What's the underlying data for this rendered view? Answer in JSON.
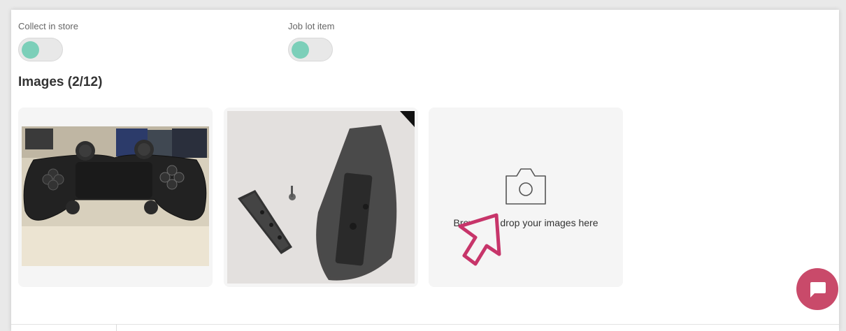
{
  "toggles": {
    "collect_in_store": {
      "label": "Collect in store",
      "on": false
    },
    "job_lot_item": {
      "label": "Job lot item",
      "on": false
    }
  },
  "images_section": {
    "title": "Images (2/12)",
    "count": 2,
    "max": 12
  },
  "uploaded_images": [
    {
      "subject": "black game controller photo"
    },
    {
      "subject": "black stand pieces photo"
    }
  ],
  "upload": {
    "text": "Browse or drop your images here",
    "icon": "camera-icon"
  },
  "chat": {
    "icon": "chat-bubble-icon"
  },
  "colors": {
    "toggle_knob": "#7ccfb9",
    "chat_button": "#c94a6a",
    "cursor": "#c7356a"
  }
}
